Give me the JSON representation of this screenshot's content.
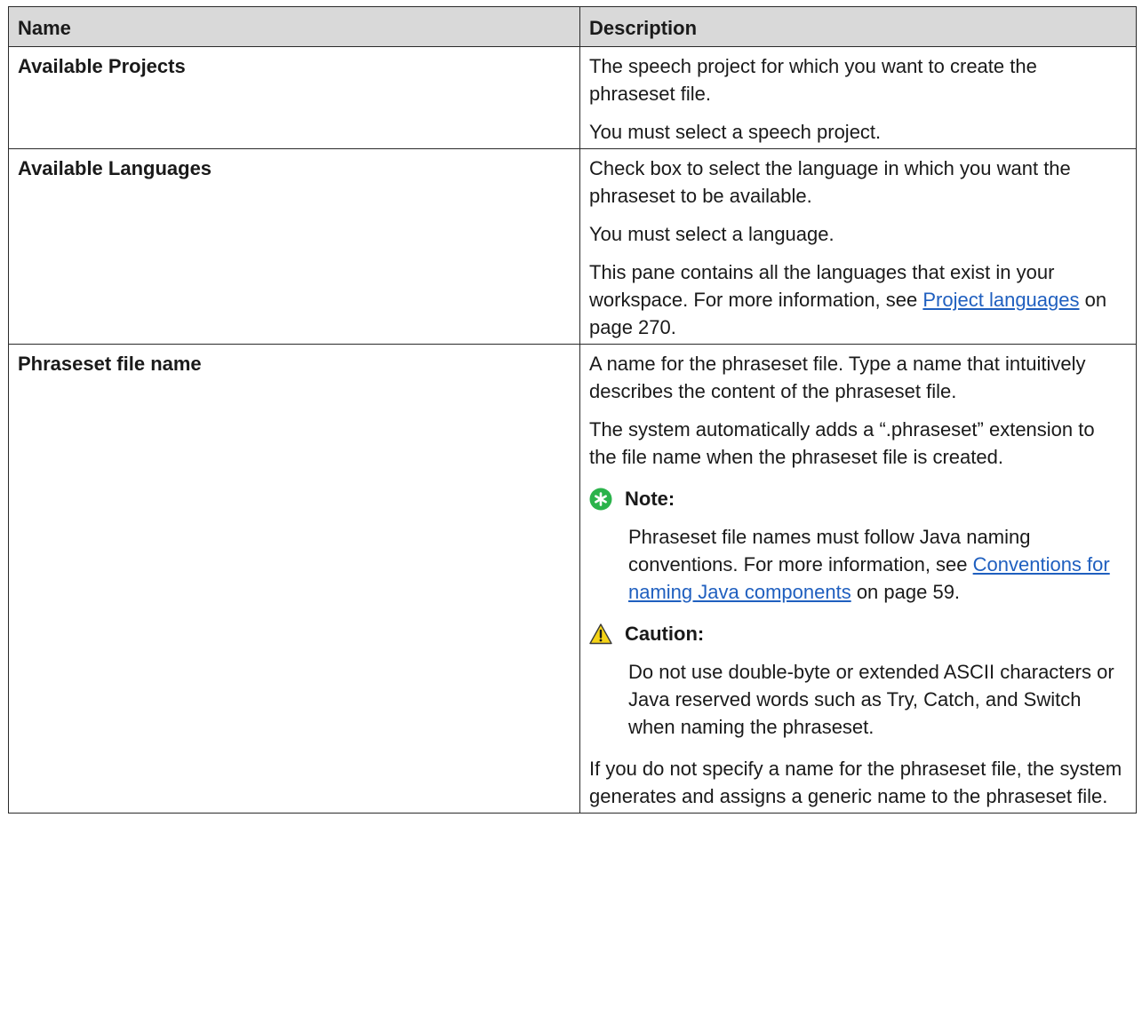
{
  "table": {
    "headers": {
      "name": "Name",
      "description": "Description"
    },
    "rows": [
      {
        "name": "Available Projects",
        "p1": "The speech project for which you want to create the phraseset file.",
        "p2": "You must select a speech project."
      },
      {
        "name": "Available Languages",
        "p1": "Check box to select the language in which you want the phraseset to be available.",
        "p2": "You must select a language.",
        "p3_before": "This pane contains all the languages that exist in your workspace. For more information, see ",
        "p3_link": "Project languages",
        "p3_after": " on page 270."
      },
      {
        "name": "Phraseset file name",
        "p1": "A name for the phraseset file. Type a name that intuitively describes the content of the phraseset file.",
        "p2": "The system automatically adds a “.phraseset” extension to the file name when the phraseset file is created.",
        "note_label": "Note:",
        "note_before": "Phraseset file names must follow Java naming conventions. For more information, see ",
        "note_link": "Conventions for naming Java components",
        "note_after": " on page 59.",
        "caution_label": "Caution:",
        "caution_text": "Do not use double-byte or extended ASCII characters or Java reserved words such as Try, Catch, and Switch when naming the phraseset.",
        "p_last": "If you do not specify a name for the phraseset file, the system generates and assigns a generic name to the phraseset file."
      }
    ]
  },
  "colors": {
    "header_bg": "#d9d9d9",
    "link": "#1f5fbf",
    "note_icon": "#2bb34b",
    "caution_icon": "#f5d316"
  },
  "icons": [
    "note-icon",
    "caution-icon"
  ]
}
